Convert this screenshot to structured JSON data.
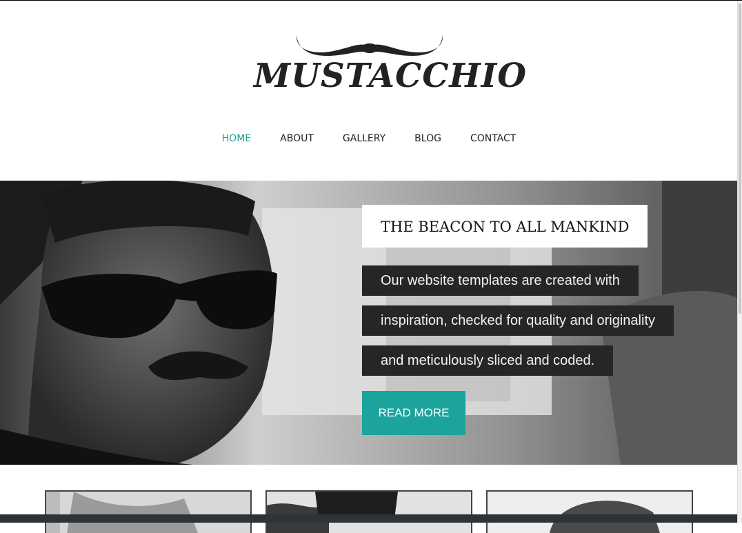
{
  "brand": {
    "logo_text": "MUSTACCHIO",
    "logo_icon": "mustache-icon"
  },
  "nav": {
    "items": [
      {
        "label": "HOME",
        "active": true
      },
      {
        "label": "ABOUT",
        "active": false
      },
      {
        "label": "GALLERY",
        "active": false
      },
      {
        "label": "BLOG",
        "active": false
      },
      {
        "label": "CONTACT",
        "active": false
      }
    ]
  },
  "hero": {
    "title": "THE BEACON TO ALL MANKIND",
    "lines": [
      "Our website templates are created with",
      "inspiration, checked for quality and originality",
      "and meticulously sliced and coded."
    ],
    "cta_label": "READ MORE"
  },
  "colors": {
    "accent": "#1ba39c",
    "dark_panel": "#262626",
    "text": "#222222"
  }
}
